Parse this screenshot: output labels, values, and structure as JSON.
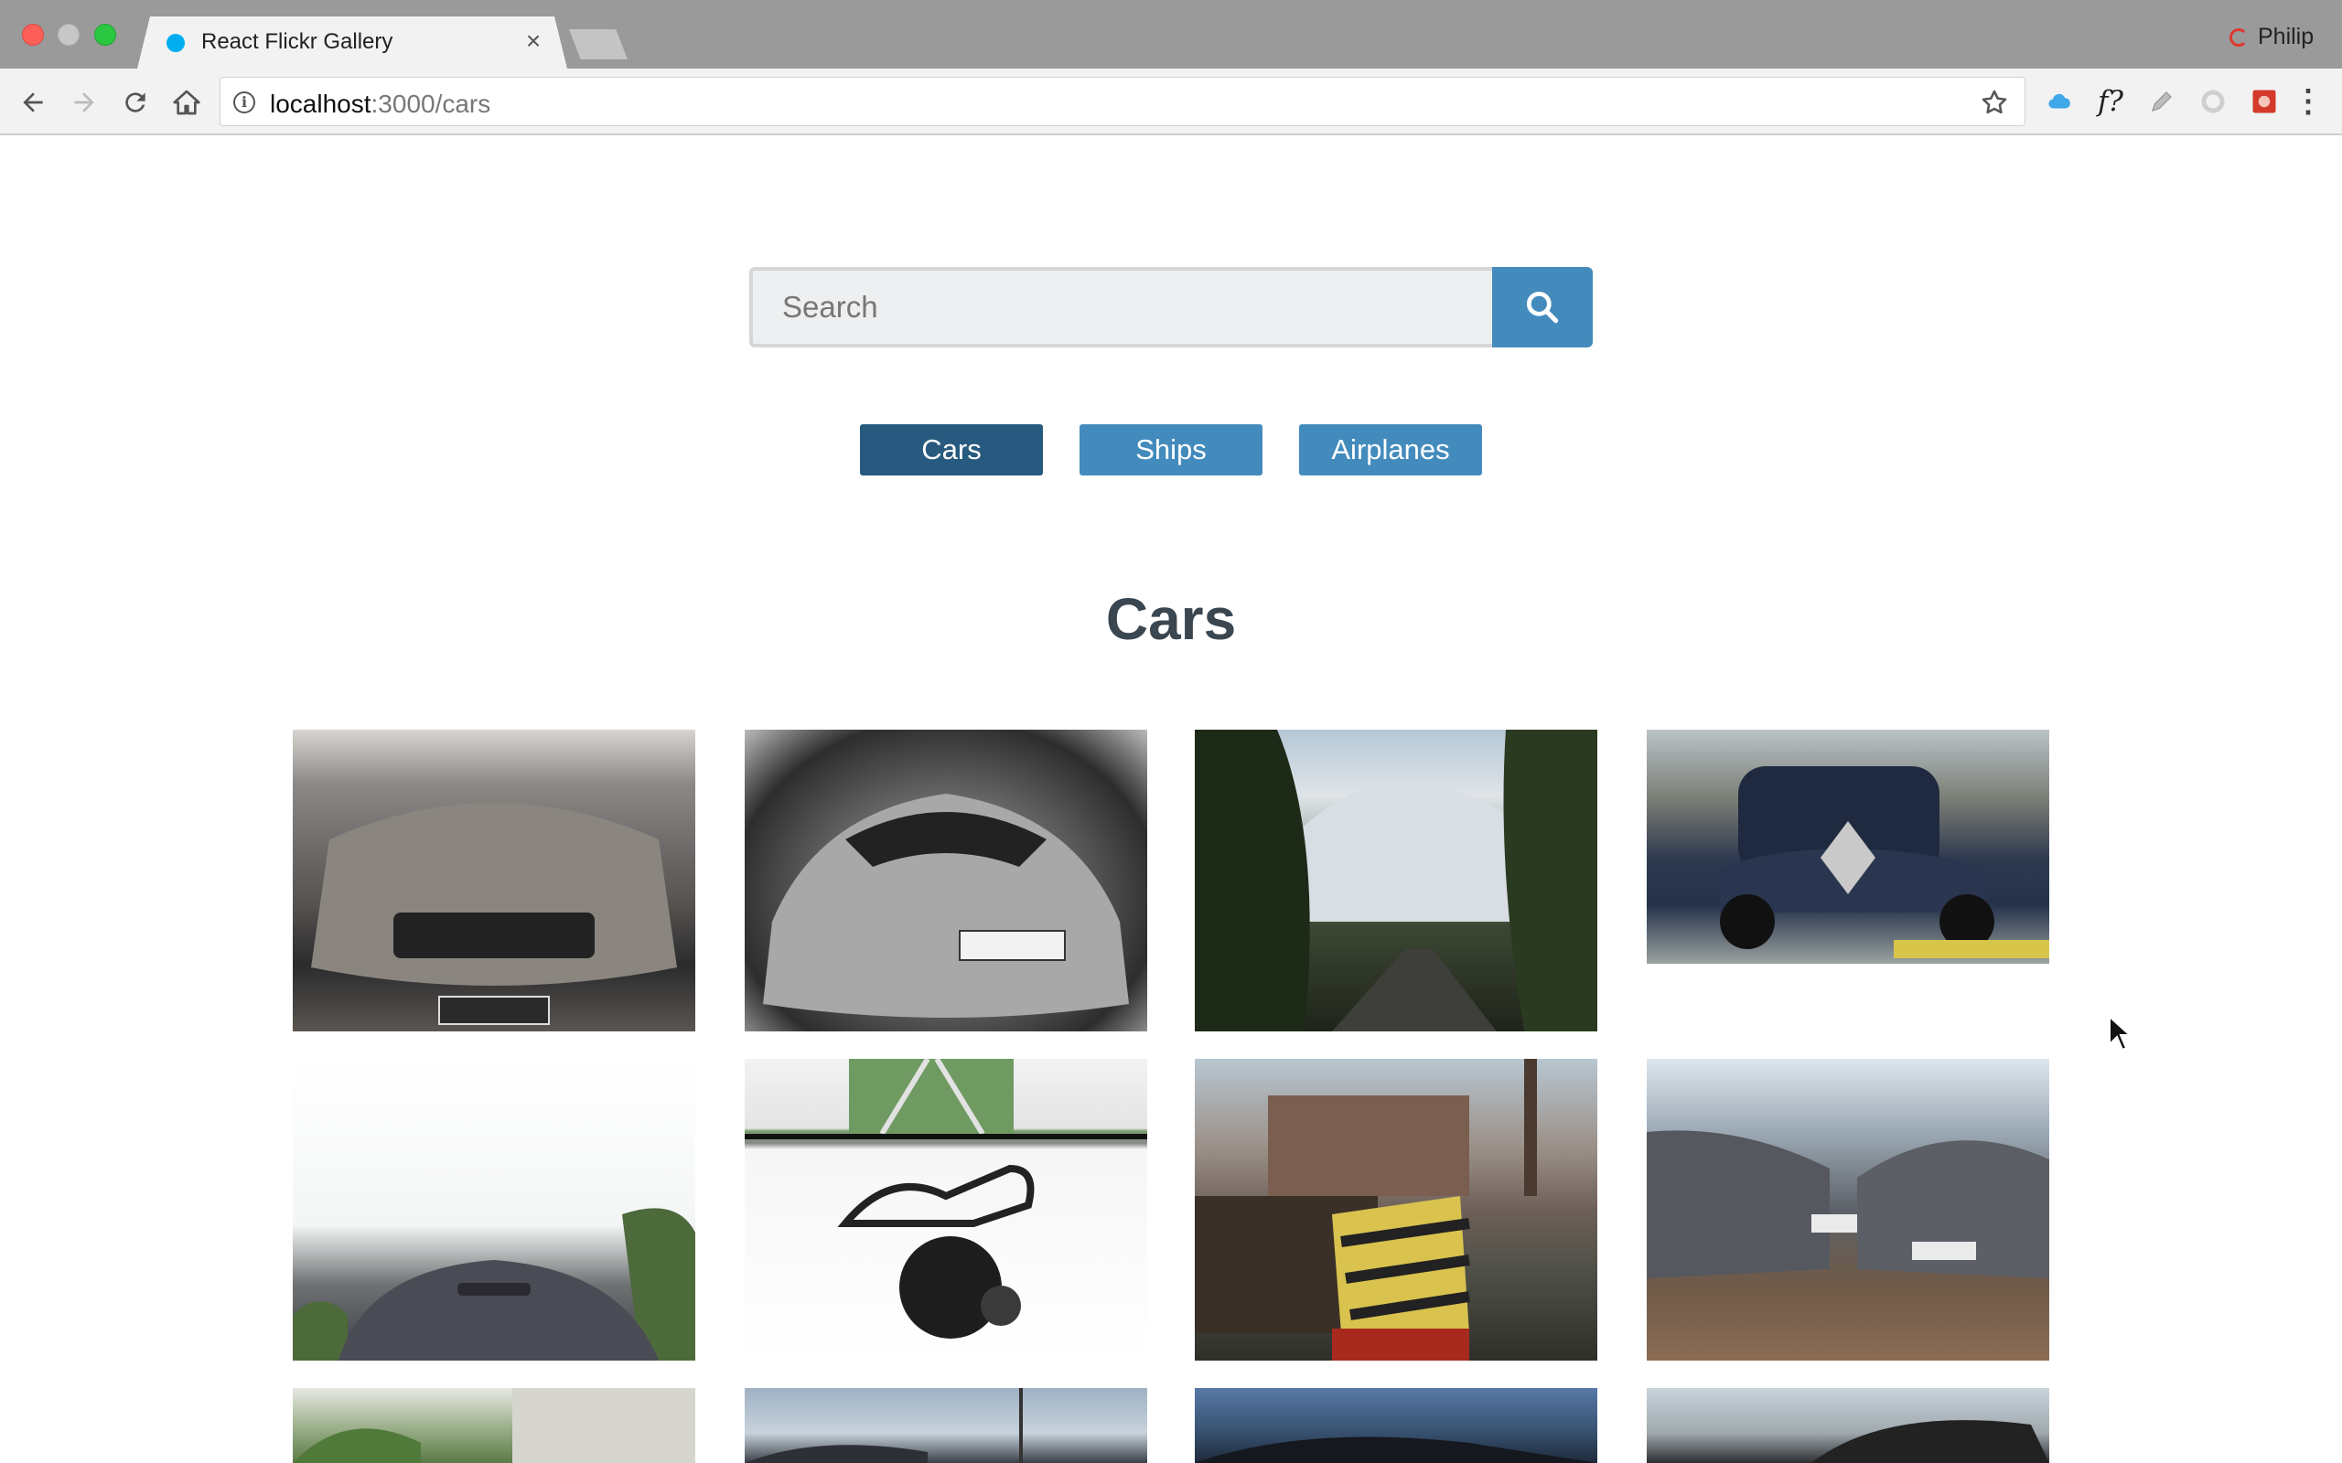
{
  "browser": {
    "tab_title": "React Flickr Gallery",
    "tab_close": "×",
    "url_host": "localhost",
    "url_path": ":3000/cars",
    "profile_name": "Philip",
    "extension_f_label": "f?",
    "menu_glyph": "⋮",
    "info_glyph": "i",
    "favicon_color": "#00aef0"
  },
  "search": {
    "placeholder": "Search"
  },
  "nav": {
    "items": [
      {
        "label": "Cars",
        "active": true
      },
      {
        "label": "Ships",
        "active": false
      },
      {
        "label": "Airplanes",
        "active": false
      }
    ]
  },
  "gallery": {
    "title": "Cars",
    "photos": [
      {
        "subject": "front of silver Toyota Innova at showroom"
      },
      {
        "subject": "black-and-white McLaren sports car"
      },
      {
        "subject": "mountain road with snowy peak"
      },
      {
        "subject": "vintage Citroën car being washed"
      },
      {
        "subject": "Subaru hood against white sky"
      },
      {
        "subject": "car backup camera product photo"
      },
      {
        "subject": "old locomotive near brick factory"
      },
      {
        "subject": "two dark BMW sedans parked"
      },
      {
        "subject": "building and trees"
      },
      {
        "subject": "car under blue sky"
      },
      {
        "subject": "dark car on road"
      },
      {
        "subject": "car roof against sky"
      }
    ]
  },
  "colors": {
    "nav_button": "#438bbd",
    "nav_button_active": "#275a7e",
    "title_text": "#3a4650"
  }
}
